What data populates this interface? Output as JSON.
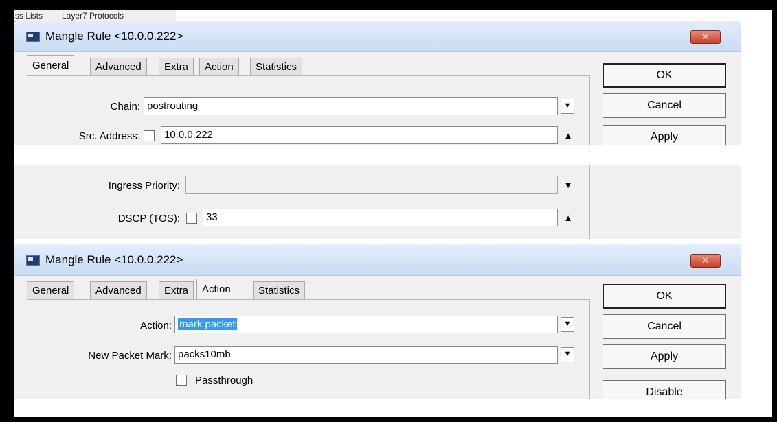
{
  "background_tabs": {
    "left_label": "ss Lists",
    "right_label": "Layer7 Protocols"
  },
  "window1": {
    "title": "Mangle Rule <10.0.0.222>",
    "close_glyph": "✕",
    "tabs": [
      "General",
      "Advanced",
      "Extra",
      "Action",
      "Statistics"
    ],
    "active_tab": "General",
    "chain_label": "Chain:",
    "chain_value": "postrouting",
    "src_address_label": "Src. Address:",
    "src_address_value": "10.0.0.222",
    "buttons": {
      "ok": "OK",
      "cancel": "Cancel",
      "apply": "Apply"
    }
  },
  "window2": {
    "ingress_priority_label": "Ingress Priority:",
    "ingress_priority_value": "",
    "dscp_label": "DSCP (TOS):",
    "dscp_value": "33"
  },
  "window3": {
    "title": "Mangle Rule <10.0.0.222>",
    "close_glyph": "✕",
    "tabs": [
      "General",
      "Advanced",
      "Extra",
      "Action",
      "Statistics"
    ],
    "active_tab": "Action",
    "action_label": "Action:",
    "action_value": "mark packet",
    "new_packet_mark_label": "New Packet Mark:",
    "new_packet_mark_value": "packs10mb",
    "passthrough_label": "Passthrough",
    "passthrough_checked": false,
    "buttons": {
      "ok": "OK",
      "cancel": "Cancel",
      "apply": "Apply",
      "disable": "Disable"
    }
  },
  "icons": {
    "dropdown": "dropdown-arrow-icon",
    "collapse": "triangle-up-icon",
    "expand": "triangle-down-icon",
    "app": "window-app-icon",
    "close": "close-icon"
  },
  "colors": {
    "titlebar_top": "#e3eefb",
    "titlebar_bottom": "#c9dcf2",
    "close": "#c9402a",
    "selection": "#3399ff"
  }
}
